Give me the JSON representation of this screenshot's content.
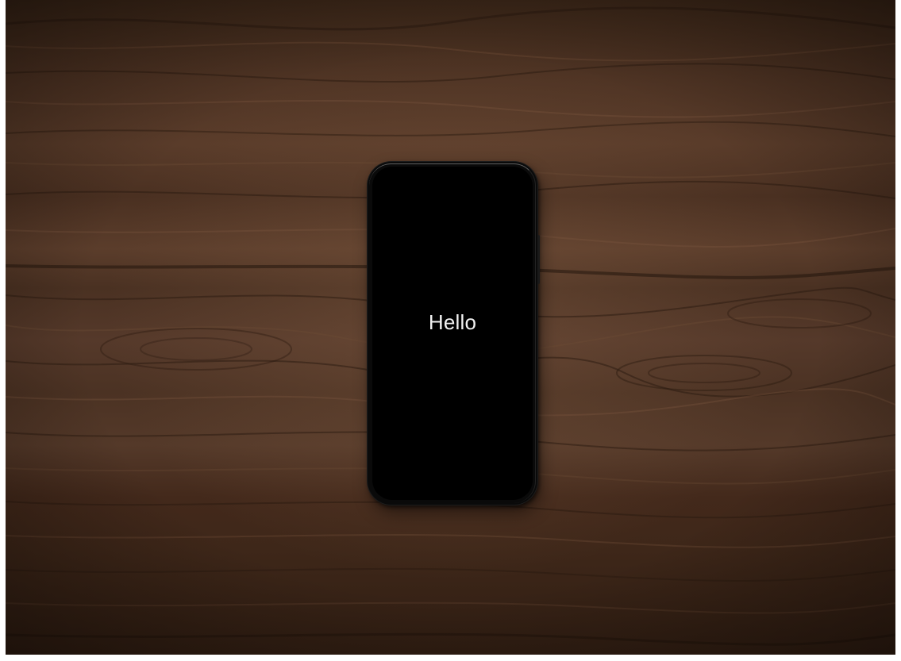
{
  "scene": {
    "background": "wood-table",
    "colors": {
      "wood_dark": "#2f1d12",
      "wood_mid": "#5a3c2a",
      "wood_light": "#8c6448",
      "phone_body": "#0a0a0a",
      "screen": "#000000",
      "text": "#f2f2f2"
    }
  },
  "phone": {
    "screen_text": "Hello"
  }
}
